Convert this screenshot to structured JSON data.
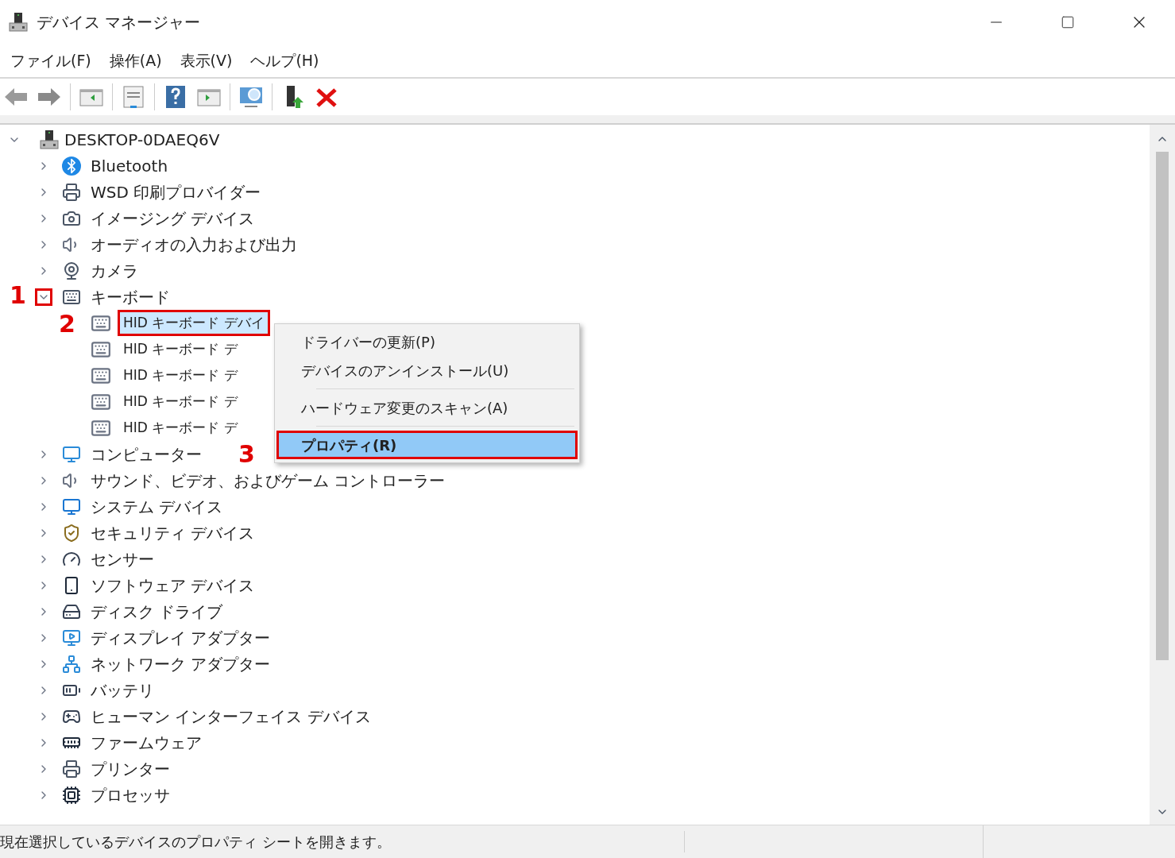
{
  "window": {
    "title": "デバイス マネージャー"
  },
  "menu_bar": [
    "ファイル(F)",
    "操作(A)",
    "表示(V)",
    "ヘルプ(H)"
  ],
  "tree": {
    "label": "DESKTOP-0DAEQ6V",
    "expanded": true,
    "children": [
      {
        "label": "Bluetooth",
        "expanded": false
      },
      {
        "label": "WSD 印刷プロバイダー",
        "expanded": false
      },
      {
        "label": "イメージング デバイス",
        "expanded": false
      },
      {
        "label": "オーディオの入力および出力",
        "expanded": false
      },
      {
        "label": "カメラ",
        "expanded": false
      },
      {
        "label": "キーボード",
        "expanded": true,
        "children": [
          {
            "label": "HID キーボード デバイ",
            "selected": true
          },
          {
            "label": "HID キーボード デ",
            "selected": false
          },
          {
            "label": "HID キーボード デ",
            "selected": false
          },
          {
            "label": "HID キーボード デ",
            "selected": false
          },
          {
            "label": "HID キーボード デ",
            "selected": false
          }
        ]
      },
      {
        "label": "コンピューター",
        "expanded": false
      },
      {
        "label": "サウンド、ビデオ、およびゲーム コントローラー",
        "expanded": false
      },
      {
        "label": "システム デバイス",
        "expanded": false
      },
      {
        "label": "セキュリティ デバイス",
        "expanded": false
      },
      {
        "label": "センサー",
        "expanded": false
      },
      {
        "label": "ソフトウェア デバイス",
        "expanded": false
      },
      {
        "label": "ディスク ドライブ",
        "expanded": false
      },
      {
        "label": "ディスプレイ アダプター",
        "expanded": false
      },
      {
        "label": "ネットワーク アダプター",
        "expanded": false
      },
      {
        "label": "バッテリ",
        "expanded": false
      },
      {
        "label": "ヒューマン インターフェイス デバイス",
        "expanded": false
      },
      {
        "label": "ファームウェア",
        "expanded": false
      },
      {
        "label": "プリンター",
        "expanded": false
      },
      {
        "label": "プロセッサ",
        "expanded": false
      }
    ]
  },
  "context_menu": [
    {
      "kind": "item",
      "label": "ドライバーの更新(P)",
      "selected": false
    },
    {
      "kind": "item",
      "label": "デバイスのアンインストール(U)",
      "selected": false
    },
    {
      "kind": "separator"
    },
    {
      "kind": "item",
      "label": "ハードウェア変更のスキャン(A)",
      "selected": false
    },
    {
      "kind": "separator"
    },
    {
      "kind": "item",
      "label": "プロパティ(R)",
      "selected": true
    }
  ],
  "annotations": [
    "1",
    "2",
    "3"
  ],
  "status_bar": {
    "text": "現在選択しているデバイスのプロパティ シートを開きます。"
  }
}
